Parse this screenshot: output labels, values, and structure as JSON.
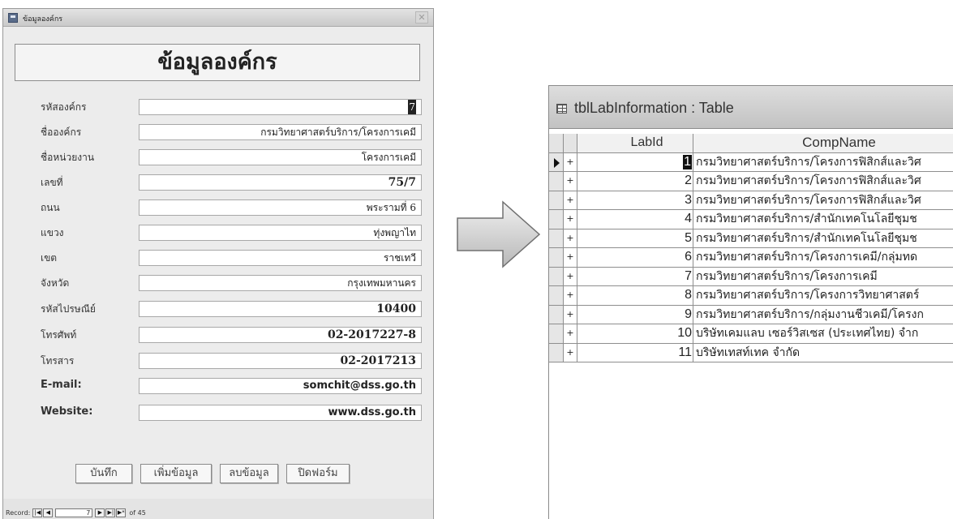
{
  "form_window": {
    "title": "ข้อมูลองค์กร",
    "header": "ข้อมูลองค์กร",
    "fields": [
      {
        "label": "รหัสองค์กร",
        "value": "7"
      },
      {
        "label": "ชื่อองค์กร",
        "value": "กรมวิทยาศาสตร์บริการ/โครงการเคมี"
      },
      {
        "label": "ชื่อหน่วยงาน",
        "value": "โครงการเคมี"
      },
      {
        "label": "เลขที่",
        "value": "75/7"
      },
      {
        "label": "ถนน",
        "value": "พระรามที่ 6"
      },
      {
        "label": "แขวง",
        "value": "ทุ่งพญาไท"
      },
      {
        "label": "เขต",
        "value": "ราชเทวี"
      },
      {
        "label": "จังหวัด",
        "value": "กรุงเทพมหานคร"
      },
      {
        "label": "รหัสไปรษณีย์",
        "value": "10400"
      },
      {
        "label": "โทรศัพท์",
        "value": "02-2017227-8"
      },
      {
        "label": "โทรสาร",
        "value": "02-2017213"
      },
      {
        "label": "E-mail:",
        "value": "somchit@dss.go.th"
      },
      {
        "label": "Website:",
        "value": "www.dss.go.th"
      }
    ],
    "buttons": {
      "save": "บันทึก",
      "add": "เพิ่มข้อมูล",
      "delete": "ลบข้อมูล",
      "close": "ปิดฟอร์ม"
    },
    "navigator": {
      "record_label": "Record:",
      "current": "7",
      "of_label": "of 45"
    }
  },
  "table_window": {
    "title": "tblLabInformation : Table",
    "columns": [
      "LabId",
      "CompName"
    ],
    "rows": [
      {
        "id": "1",
        "name": "กรมวิทยาศาสตร์บริการ/โครงการฟิสิกส์และวิศ"
      },
      {
        "id": "2",
        "name": "กรมวิทยาศาสตร์บริการ/โครงการฟิสิกส์และวิศ"
      },
      {
        "id": "3",
        "name": "กรมวิทยาศาสตร์บริการ/โครงการฟิสิกส์และวิศ"
      },
      {
        "id": "4",
        "name": "กรมวิทยาศาสตร์บริการ/สำนักเทคโนโลยีชุมช"
      },
      {
        "id": "5",
        "name": "กรมวิทยาศาสตร์บริการ/สำนักเทคโนโลยีชุมช"
      },
      {
        "id": "6",
        "name": "กรมวิทยาศาสตร์บริการ/โครงการเคมี/กลุ่มทด"
      },
      {
        "id": "7",
        "name": "กรมวิทยาศาสตร์บริการ/โครงการเคมี"
      },
      {
        "id": "8",
        "name": "กรมวิทยาศาสตร์บริการ/โครงการวิทยาศาสตร์"
      },
      {
        "id": "9",
        "name": "กรมวิทยาศาสตร์บริการ/กลุ่มงานชีวเคมี/โครงก"
      },
      {
        "id": "10",
        "name": "บริษัทเคมแลบ เซอร์วิสเซส (ประเทศไทย) จำก"
      },
      {
        "id": "11",
        "name": "บริษัทเทสท์เทค จำกัด"
      }
    ]
  },
  "icons": {
    "form_app": "form-icon",
    "form_close": "close-icon",
    "table_app": "table-icon",
    "arrow": "right-arrow-icon",
    "expand": "plus-icon",
    "current_record": "record-selector-icon"
  }
}
